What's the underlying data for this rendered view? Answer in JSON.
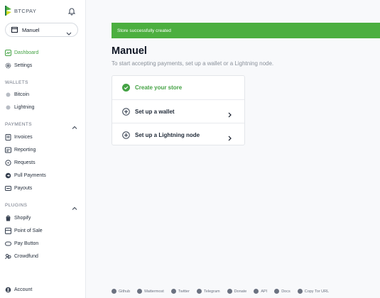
{
  "brand": {
    "name": "BTCPAY"
  },
  "store_selector": {
    "value": "Manuel"
  },
  "nav": {
    "dashboard": "Dashboard",
    "settings": "Settings",
    "wallets_title": "WALLETS",
    "wallets": [
      "Bitcoin",
      "Lightning"
    ],
    "payments_title": "PAYMENTS",
    "payments": [
      "Invoices",
      "Reporting",
      "Requests",
      "Pull Payments",
      "Payouts"
    ],
    "plugins_title": "PLUGINS",
    "plugins": [
      "Shopify",
      "Point of Sale",
      "Pay Button",
      "Crowdfund"
    ],
    "account": "Account"
  },
  "flash": {
    "message": "Store successfully created"
  },
  "main": {
    "title": "Manuel",
    "subtitle": "To start accepting payments, set up a wallet or a Lightning node.",
    "steps": [
      {
        "label": "Create your store"
      },
      {
        "label": "Set up a wallet"
      },
      {
        "label": "Set up a Lightning node"
      }
    ]
  },
  "footer": {
    "links": [
      "Github",
      "Mattermost",
      "Twitter",
      "Telegram",
      "Donate",
      "API",
      "Docs",
      "Copy Tor URL"
    ]
  },
  "colors": {
    "accent": "#44a244",
    "flash_bg": "#4caf3f"
  }
}
